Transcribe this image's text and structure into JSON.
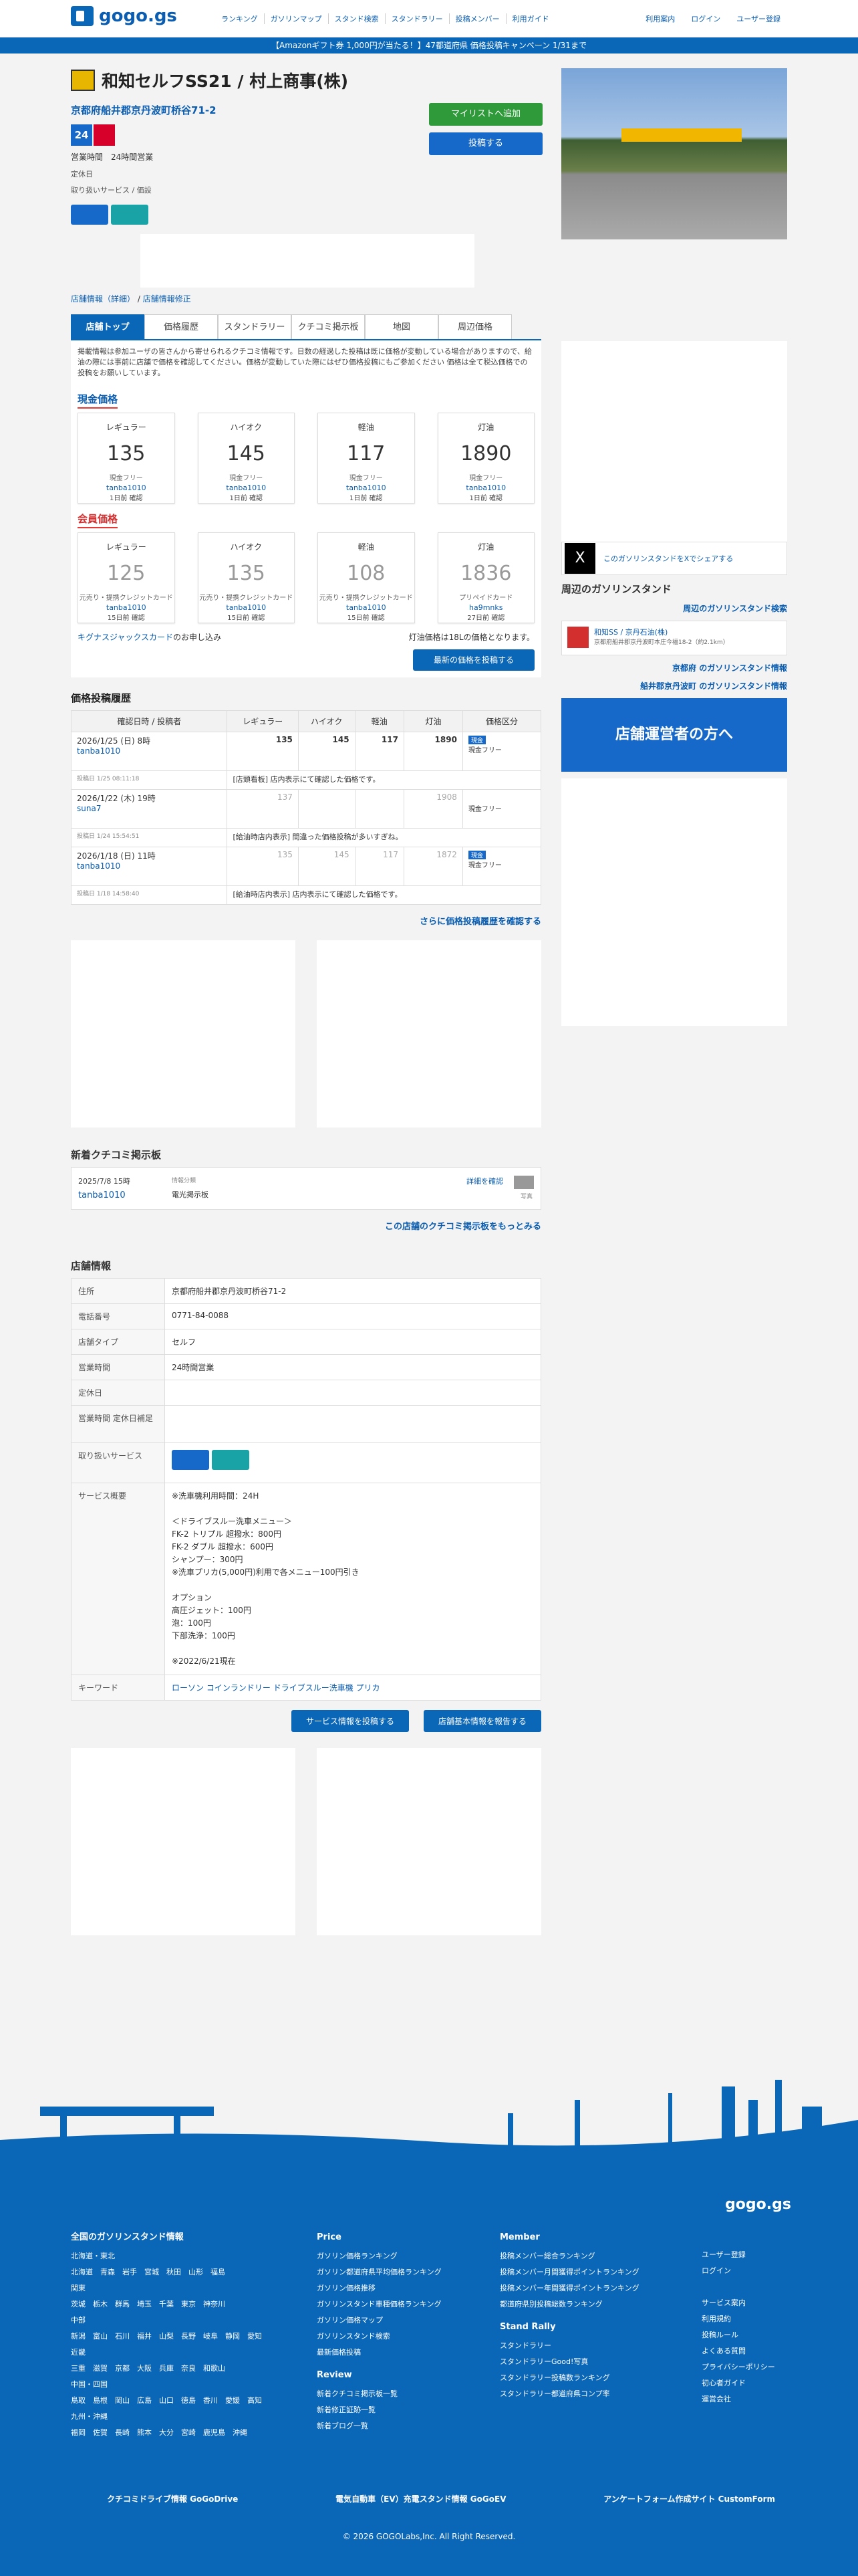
{
  "header": {
    "logo": "gogo.gs",
    "nav": [
      "ランキング",
      "ガソリンマップ",
      "スタンド検索",
      "スタンドラリー",
      "投稿メンバー",
      "利用ガイド"
    ],
    "right": [
      "利用案内",
      "ログイン",
      "ユーザー登録"
    ]
  },
  "banner": "【Amazonギフト券 1,000円が当たる！】47都道府県 価格投稿キャンペーン 1/31まで",
  "station": {
    "title": "和知セルフSS21 / 村上商事(株)",
    "address": "京都府船井郡京丹波町桥谷71-2",
    "badge24": "24",
    "hours_line": "営業時間　24時間営業",
    "closed_line": "定休日",
    "svc_line": "取り扱いサービス / 価設"
  },
  "buttons": {
    "mylist": "マイリストへ追加",
    "post": "投稿する"
  },
  "links": {
    "a": "店舗情報（詳細）",
    "b": "店舗情報修正"
  },
  "tabs": [
    "店舗トップ",
    "価格履歴",
    "スタンドラリー",
    "クチコミ掲示板",
    "地図",
    "周辺価格"
  ],
  "note": "掲載情報は参加ユーザの皆さんから寄せられるクチコミ情報です。日数の経過した投稿は既に価格が変動している場合がありますので、給油の際には事前に店舗で価格を確認してください。価格が変動していた際にはぜひ価格投稿にもご参加ください 価格は全て税込価格での投稿をお願いしています。",
  "genkin": {
    "heading": "現金価格",
    "cards": [
      {
        "label": "レギュラー",
        "price": "135",
        "sub": "現金フリー",
        "user": "tanba1010",
        "ago": "1日前 確認"
      },
      {
        "label": "ハイオク",
        "price": "145",
        "sub": "現金フリー",
        "user": "tanba1010",
        "ago": "1日前 確認"
      },
      {
        "label": "軽油",
        "price": "117",
        "sub": "現金フリー",
        "user": "tanba1010",
        "ago": "1日前 確認"
      },
      {
        "label": "灯油",
        "price": "1890",
        "sub": "現金フリー",
        "user": "tanba1010",
        "ago": "1日前 確認"
      }
    ]
  },
  "member": {
    "heading": "会員価格",
    "cards": [
      {
        "label": "レギュラー",
        "price": "125",
        "sub": "元売り・提携クレジットカード",
        "user": "tanba1010",
        "ago": "15日前 確認"
      },
      {
        "label": "ハイオク",
        "price": "135",
        "sub": "元売り・提携クレジットカード",
        "user": "tanba1010",
        "ago": "15日前 確認"
      },
      {
        "label": "軽油",
        "price": "108",
        "sub": "元売り・提携クレジットカード",
        "user": "tanba1010",
        "ago": "15日前 確認"
      },
      {
        "label": "灯油",
        "price": "1836",
        "sub": "プリペイドカード",
        "user": "ha9mnks",
        "ago": "27日前 確認"
      }
    ]
  },
  "kigunasu": "キグナスジャックスカード",
  "kigunasu_suffix": "のお申し込み",
  "toyu_note": "灯油価格は18Lの価格となります。",
  "post_latest": "最新の価格を投稿する",
  "history": {
    "heading": "価格投稿履歴",
    "cols": [
      "確認日時 / 投稿者",
      "レギュラー",
      "ハイオク",
      "軽油",
      "灯油",
      "価格区分"
    ],
    "rows": [
      {
        "date": "2026/1/25 (日) 8時",
        "user": "tanba1010",
        "v": [
          "135",
          "145",
          "117",
          "1890"
        ],
        "tag": "現金",
        "kind": "現金フリー",
        "meta": "投稿日 1/25 08:11:18",
        "comment": "[店頭看板] 店内表示にて確認した価格です。"
      },
      {
        "date": "2026/1/22 (木) 19時",
        "user": "suna7",
        "v": [
          "137",
          "",
          "",
          "1908"
        ],
        "tag": "",
        "kind": "現金フリー",
        "meta": "投稿日 1/24 15:54:51",
        "comment": "[給油時店内表示] 間違った価格投稿が多いすぎね。"
      },
      {
        "date": "2026/1/18 (日) 11時",
        "user": "tanba1010",
        "v": [
          "135",
          "145",
          "117",
          "1872"
        ],
        "tag": "現金",
        "kind": "現金フリー",
        "meta": "投稿日 1/18 14:58:40",
        "comment": "[給油時店内表示] 店内表示にて確認した価格です。"
      }
    ]
  },
  "history_more": "さらに価格投稿履歴を確認する",
  "kuchi": {
    "heading": "新着クチコミ掲示板",
    "date": "2025/7/8 15時",
    "user": "tanba1010",
    "cat_label": "情報分類",
    "cat": "電光掲示板",
    "detail": "詳細を確認",
    "photo": "写真",
    "more": "この店舗のクチコミ掲示板をもっとみる"
  },
  "info": {
    "heading": "店舗情報",
    "rows": [
      {
        "k": "住所",
        "v": "京都府船井郡京丹波町桥谷71-2"
      },
      {
        "k": "電話番号",
        "v": "0771-84-0088"
      },
      {
        "k": "店舗タイプ",
        "v": "セルフ"
      },
      {
        "k": "営業時間",
        "v": "24時間営業"
      },
      {
        "k": "定休日",
        "v": ""
      },
      {
        "k": "営業時間 定休日補足",
        "v": ""
      },
      {
        "k": "取り扱いサービス",
        "v": ""
      }
    ],
    "service_k": "サービス概要",
    "service": [
      "※洗車機利用時間：24H",
      "",
      "＜ドライブスルー洗車メニュー＞",
      "FK-2 トリプル 超撥水：800円",
      "FK-2 ダブル 超撥水：600円",
      "シャンプー：300円",
      "※洗車プリカ(5,000円)利用で各メニュー100円引き",
      "",
      "オプション",
      "高圧ジェット：100円",
      "泡：100円",
      "下部洗浄：100円",
      "",
      "※2022/6/21現在"
    ],
    "kw_k": "キーワード",
    "kw": [
      "ローソン",
      "コインランドリー",
      "ドライブスルー洗車機",
      "プリカ"
    ]
  },
  "info_btns": [
    "サービス情報を投稿する",
    "店舗基本情報を報告する"
  ],
  "side": {
    "share": "このガソリンスタンドをXでシェアする",
    "near_h": "周辺のガソリンスタンド",
    "near_search": "周辺のガソリンスタンド検索",
    "near_name": "和知SS / 京丹石油(株)",
    "near_addr": "京都府船井郡京丹波町本庄今福18-2（約2.1km）",
    "pref_link": "京都府 のガソリンスタンド情報",
    "city_link": "船井郡京丹波町 のガソリンスタンド情報",
    "owner": "店舗運営者の方へ"
  },
  "footer": {
    "logo": "gogo.gs",
    "col1_h": "全国のガソリンスタンド情報",
    "regions": [
      {
        "n": "北海道・東北",
        "p": "北海道　青森　岩手　宮城　秋田　山形　福島"
      },
      {
        "n": "関東",
        "p": "茨城　栃木　群馬　埼玉　千葉　東京　神奈川"
      },
      {
        "n": "中部",
        "p": "新潟　富山　石川　福井　山梨　長野　岐阜　静岡　愛知"
      },
      {
        "n": "近畿",
        "p": "三重　滋賀　京都　大阪　兵庫　奈良　和歌山"
      },
      {
        "n": "中国・四国",
        "p": "鳥取　島根　岡山　広島　山口　徳島　香川　愛媛　高知"
      },
      {
        "n": "九州・沖縄",
        "p": "福岡　佐賀　長崎　熊本　大分　宮崎　鹿児島　沖縄"
      }
    ],
    "price_h": "Price",
    "price": [
      "ガソリン価格ランキング",
      "ガソリン都道府県平均価格ランキング",
      "ガソリン価格推移",
      "ガソリンスタンド車種価格ランキング",
      "ガソリン価格マップ",
      "ガソリンスタンド検索",
      "最新価格投稿"
    ],
    "review_h": "Review",
    "review": [
      "新着クチコミ掲示板一覧",
      "新着修正証跡一覧",
      "新着ブログ一覧"
    ],
    "member_h": "Member",
    "member": [
      "投稿メンバー総合ランキング",
      "投稿メンバー月間獲得ポイントランキング",
      "投稿メンバー年間獲得ポイントランキング",
      "都道府県別投稿総数ランキング"
    ],
    "rally_h": "Stand Rally",
    "rally": [
      "スタンドラリー",
      "スタンドラリーGood!写真",
      "スタンドラリー投稿数ランキング",
      "スタンドラリー都道府県コンプ率"
    ],
    "right": [
      "ユーザー登録",
      "ログイン",
      "",
      "サービス案内",
      "利用規約",
      "投稿ルール",
      "よくある質問",
      "プライバシーポリシー",
      "初心者ガイド",
      "運営会社"
    ],
    "bottom": [
      "クチコミドライブ情報 GoGoDrive",
      "電気自動車（EV）充電スタンド情報 GoGoEV",
      "アンケートフォーム作成サイト CustomForm"
    ],
    "copy": "© 2026 GOGOLabs,Inc. All Right Reserved."
  }
}
